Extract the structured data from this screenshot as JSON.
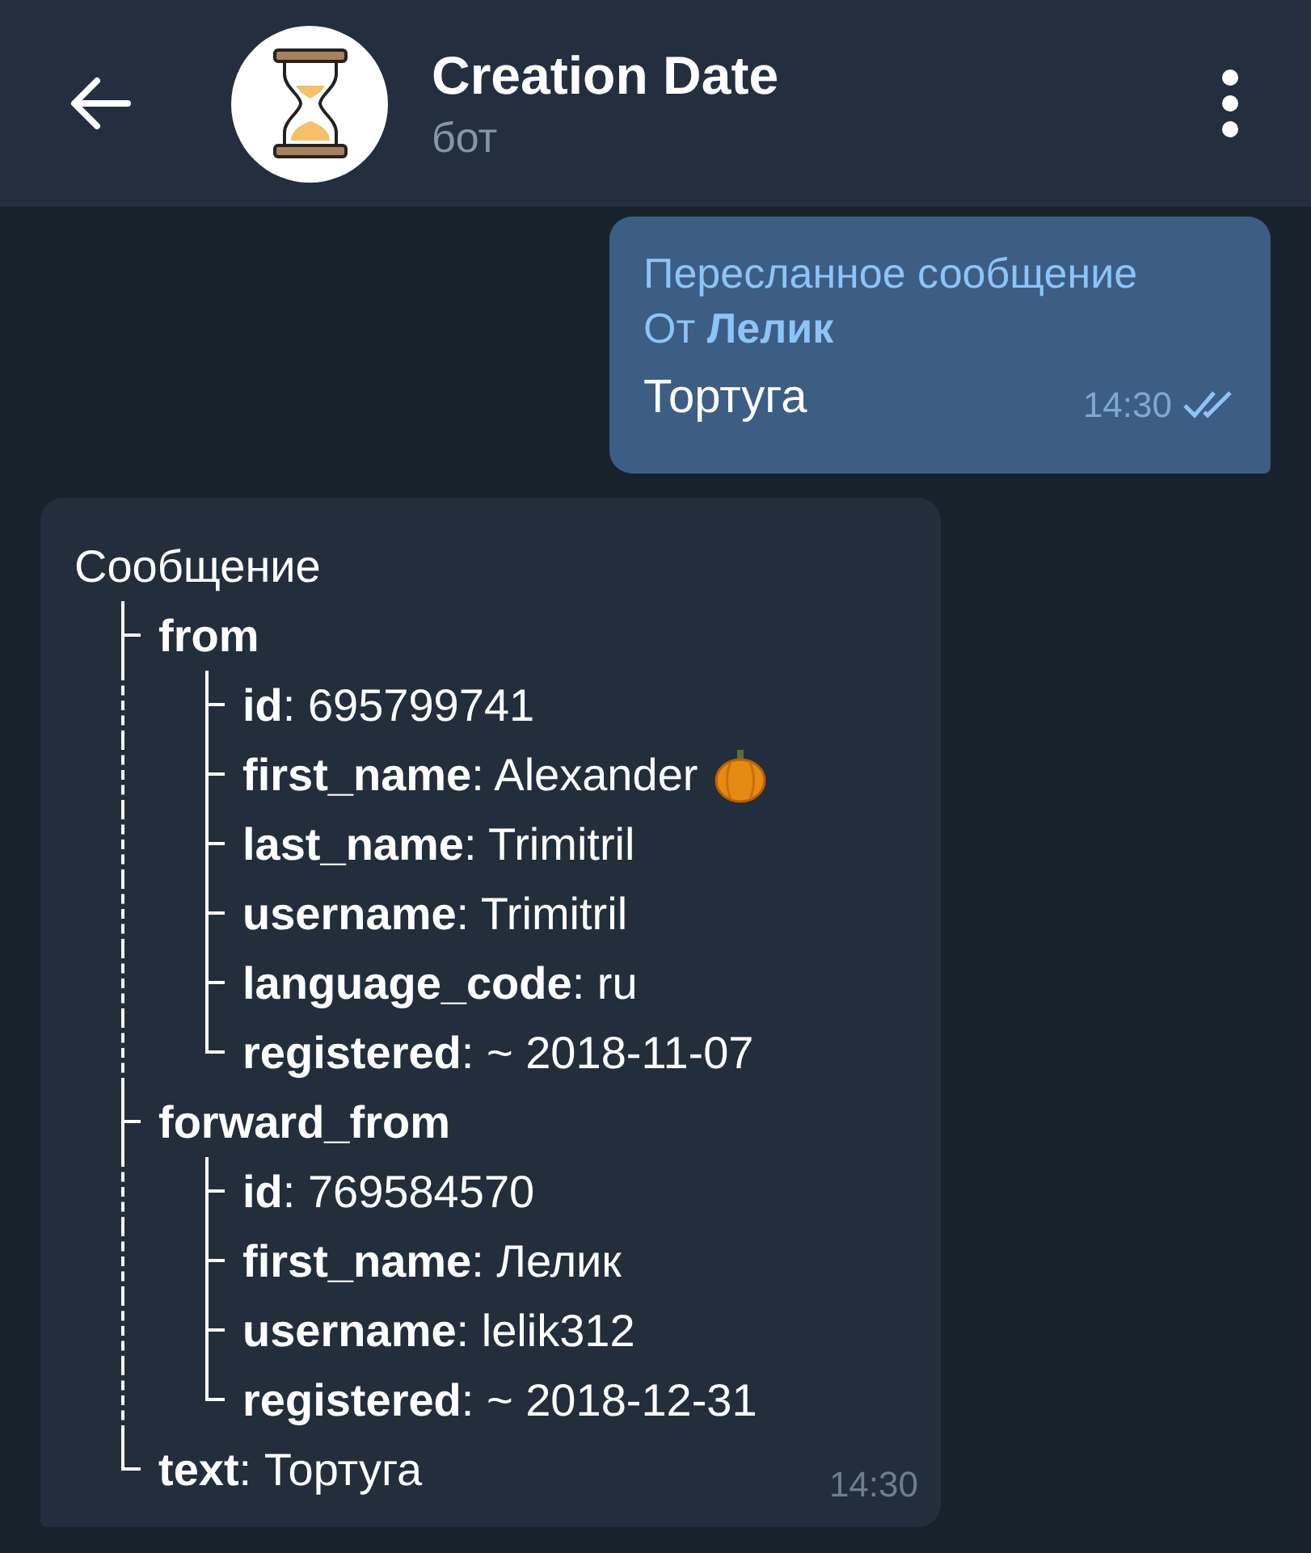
{
  "header": {
    "title": "Creation Date",
    "subtitle": "бот"
  },
  "messages": [
    {
      "kind": "outgoing",
      "forward_label": "Пересланное сообщение",
      "forward_from": "От **Лелик**",
      "text": "Тортуга",
      "time": "14:30",
      "read": true
    },
    {
      "kind": "incoming",
      "time": "14:30",
      "tree": {
        "text": "Сообщение",
        "children": [
          {
            "text": "**from**",
            "children": [
              {
                "text": "**id**: 695799741",
                "pumpkin": false
              },
              {
                "text": "**first_name**: Alexander",
                "pumpkin": true
              },
              {
                "text": "**last_name**: Trimitril",
                "pumpkin": false
              },
              {
                "text": "**username**: Trimitril",
                "pumpkin": false
              },
              {
                "text": "**language_code**: ru",
                "pumpkin": false
              },
              {
                "text": "**registered**: ~ 2018-11-07",
                "pumpkin": false
              }
            ]
          },
          {
            "text": "**forward_from**",
            "children": [
              {
                "text": "**id**: 769584570"
              },
              {
                "text": "**first_name**: Лелик"
              },
              {
                "text": "**username**: lelik312"
              },
              {
                "text": "**registered**: ~ 2018-12-31"
              }
            ]
          },
          {
            "text": "**text**: Тортуга"
          }
        ]
      }
    }
  ]
}
